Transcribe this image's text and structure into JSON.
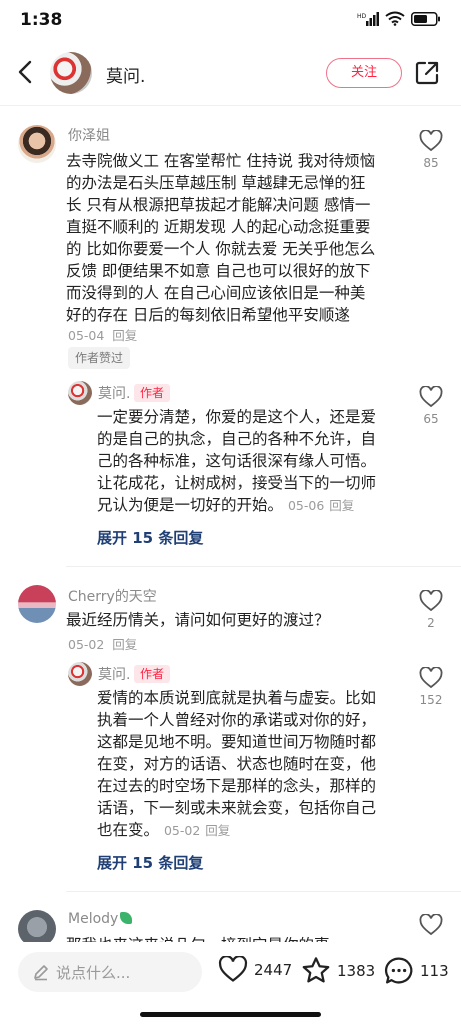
{
  "status_bar": {
    "time": "1:38",
    "battery_icon": "battery-icon",
    "wifi_icon": "wifi-icon",
    "signal_icon": "signal-icon"
  },
  "header": {
    "title": "莫问.",
    "follow_label": "关注",
    "back_icon": "chevron-left-icon",
    "share_icon": "share-icon"
  },
  "comments": [
    {
      "user": "你泽姐",
      "text_lines": [
        "去寺院做义工 在客堂帮忙 住持说 我对待烦恼",
        "的办法是石头压草越压制 草越肆无忌惮的狂",
        "长 只有从根源把草拔起才能解决问题 感情一",
        "直挺不顺利的 近期发现 人的起心动念挺重要",
        "的 比如你要爱一个人 你就去爱 无关乎他怎么",
        "反馈 即便结果不如意 自己也可以很好的放下",
        "而没得到的人 在自己心间应该依旧是一种美",
        "好的存在 日后的每刻依旧希望他平安顺遂"
      ],
      "date": "05-04",
      "reply_label": "回复",
      "liked_badge": "作者赞过",
      "likes": "85",
      "reply": {
        "user": "莫问.",
        "author_tag": "作者",
        "text_lines": [
          "一定要分清楚，你爱的是这个人，还是爱",
          "的是自己的执念，自己的各种不允许，自",
          "己的各种标准，这句话很深有缘人可悟。",
          "让花成花，让树成树，接受当下的一切师",
          "兄认为便是一切好的开始。"
        ],
        "date": "05-06",
        "reply_label": "回复",
        "likes": "65"
      },
      "expand_label": "展开 15 条回复"
    },
    {
      "user": "Cherry的天空",
      "text_lines": [
        "最近经历情关，请问如何更好的渡过？"
      ],
      "date": "05-02",
      "reply_label": "回复",
      "likes": "2",
      "reply": {
        "user": "莫问.",
        "author_tag": "作者",
        "text_lines": [
          "爱情的本质说到底就是执着与虚妄。比如",
          "执着一个人曾经对你的承诺或对你的好，",
          "这都是见地不明。要知道世间万物随时都",
          "在变，对方的话语、状态也随时在变，他",
          "在过去的时空场下是那样的念头，那样的",
          "话语，下一刻或未来就会变，包括你自己",
          "也在变。"
        ],
        "date": "05-02",
        "reply_label": "回复",
        "likes": "152"
      },
      "expand_label": "展开 15 条回复"
    },
    {
      "user": "Melody",
      "partial_text": "那我也来这来说几句，接到它是你的事"
    }
  ],
  "bottom_bar": {
    "input_placeholder": "说点什么...",
    "likes": "2447",
    "favorites": "1383",
    "comments": "113"
  },
  "colors": {
    "accent": "#ff2442",
    "link": "#1f3f75"
  }
}
